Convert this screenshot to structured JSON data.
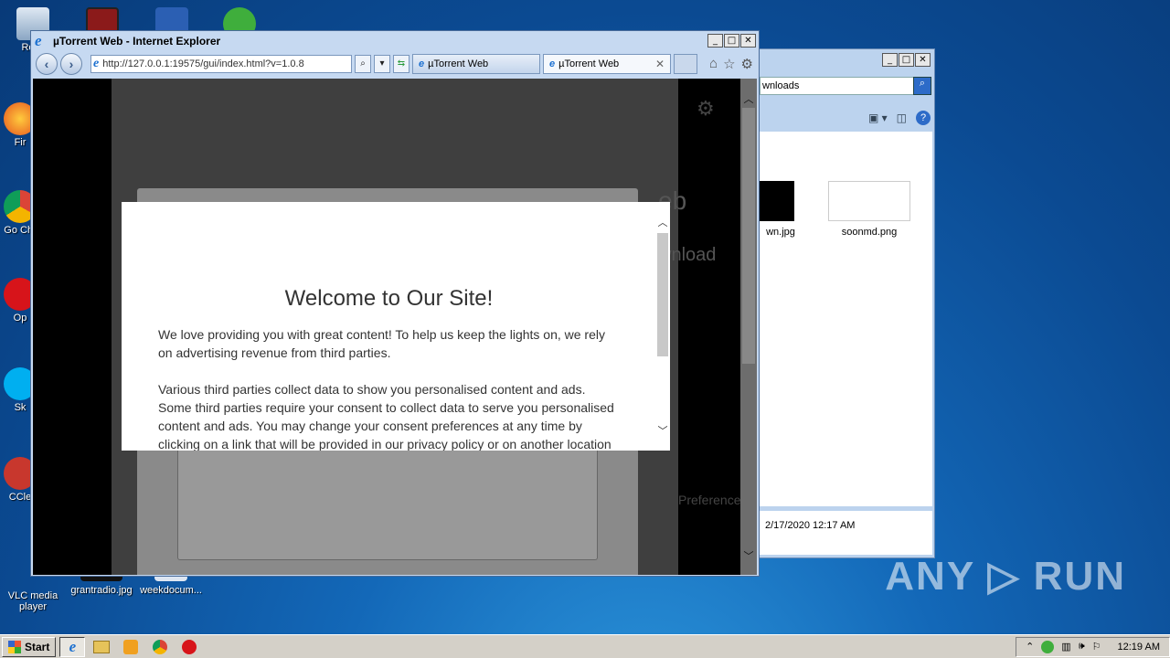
{
  "desktop": {
    "icons": [
      {
        "label": "Recy"
      },
      {
        "label": "Fir"
      },
      {
        "label": "Go Chr"
      },
      {
        "label": "Op"
      },
      {
        "label": "Sk"
      },
      {
        "label": "CCle"
      },
      {
        "label": "VLC media player"
      },
      {
        "label": "grantradio.jpg"
      },
      {
        "label": "weekdocum..."
      }
    ],
    "watermark": "ANY ▷ RUN"
  },
  "explorer": {
    "address": "wnloads",
    "files": [
      {
        "name": "wn.jpg"
      },
      {
        "name": "soonmd.png"
      }
    ],
    "details_date": "2/17/2020 12:17 AM"
  },
  "ie": {
    "title": "µTorrent Web - Internet Explorer",
    "url": "http://127.0.0.1:19575/gui/index.html?v=1.0.8",
    "tabs": [
      {
        "label": "µTorrent Web"
      },
      {
        "label": "µTorrent Web"
      }
    ],
    "page": {
      "ghost_web": "eb",
      "ghost_download": "wnload",
      "ghost_preferences": "Preference"
    },
    "modal": {
      "heading": "Welcome to Our Site!",
      "paragraph1": "We love providing you with great content! To help us keep the lights on, we rely on advertising revenue from third parties.",
      "paragraph2": "Various third parties collect data to show you personalised content and ads. Some third parties require your consent to collect data to serve you personalised content and ads. You may change your consent preferences at any time by clicking on a link that will be provided in our privacy policy or on another location"
    }
  },
  "taskbar": {
    "start_label": "Start",
    "clock": "12:19 AM"
  }
}
